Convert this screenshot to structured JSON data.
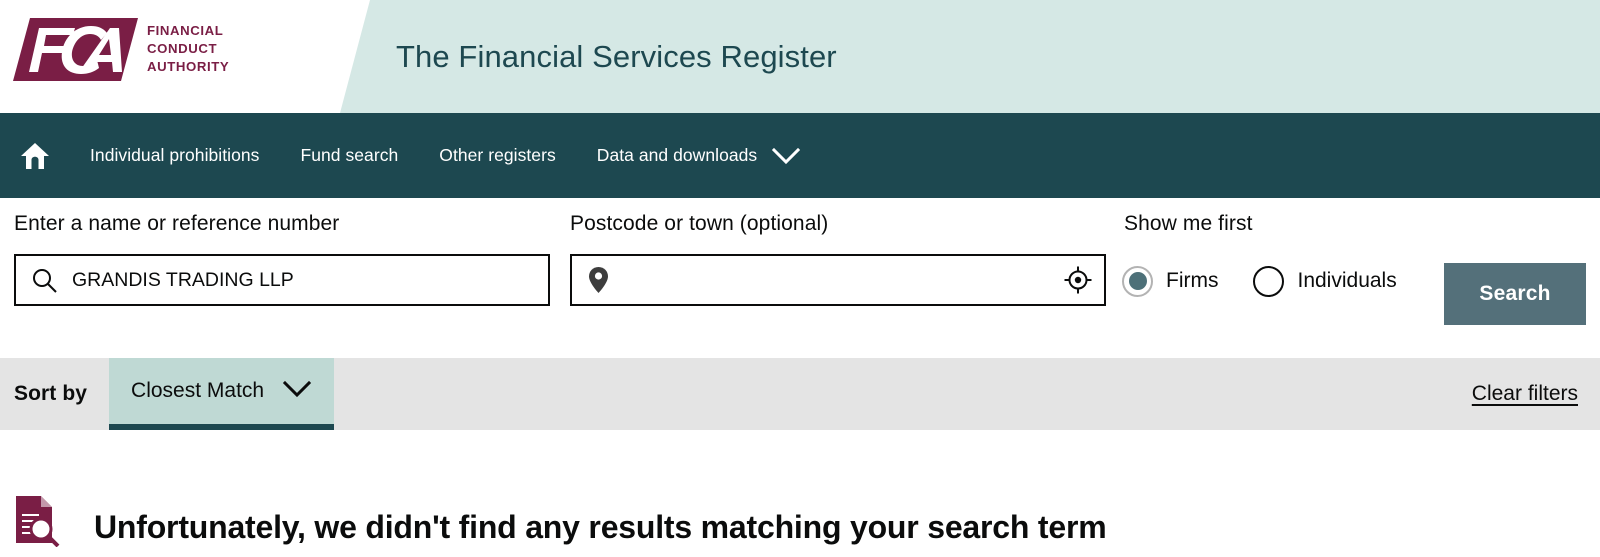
{
  "header": {
    "logo_words": "Financial\nConduct\nAuthority",
    "logo_line1": "FINANCIAL",
    "logo_line2": "CONDUCT",
    "logo_line3": "AUTHORITY",
    "logo_text": "FCA",
    "title": "The Financial Services Register",
    "brand_color": "#7a1e45",
    "banner_color": "#d5e8e5"
  },
  "nav": {
    "home_icon": "home-icon",
    "items": [
      {
        "label": "Individual prohibitions"
      },
      {
        "label": "Fund search"
      },
      {
        "label": "Other registers"
      },
      {
        "label": "Data and downloads",
        "caret": true
      }
    ],
    "bar_color": "#1d4850"
  },
  "search": {
    "name_label": "Enter a name or reference number",
    "name_value": "GRANDIS TRADING LLP",
    "name_placeholder": "",
    "name_icon": "search-icon",
    "postcode_label": "Postcode or town (optional)",
    "postcode_value": "",
    "postcode_placeholder": "",
    "postcode_icon": "map-pin-icon",
    "geolocate_icon": "crosshair-icon",
    "show_me_first_label": "Show me first",
    "options": [
      {
        "label": "Firms",
        "selected": true
      },
      {
        "label": "Individuals",
        "selected": false
      }
    ],
    "search_button": "Search",
    "search_button_color": "#54707a"
  },
  "sortbar": {
    "sort_by_label": "Sort by",
    "selected_sort": "Closest Match",
    "caret_icon": "chevron-down-icon",
    "clear_filters": "Clear filters",
    "bar_color": "#e4e4e4",
    "tab_color": "#bfd9d4"
  },
  "results": {
    "icon": "document-search-icon",
    "message": "Unfortunately, we didn't find any results matching your search term"
  }
}
